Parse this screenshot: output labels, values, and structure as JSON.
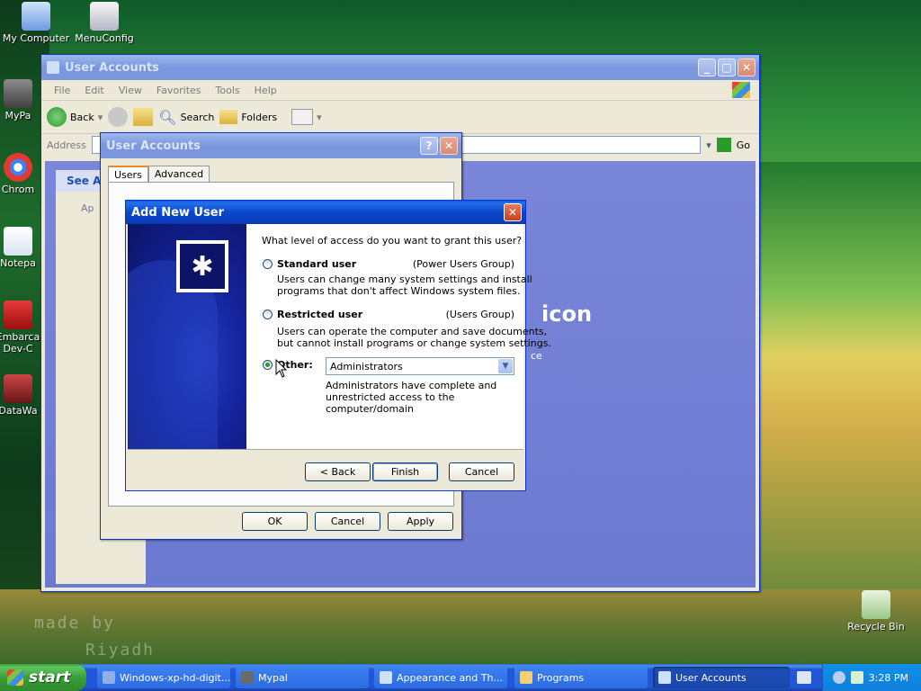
{
  "desktop": {
    "icons": [
      {
        "label": "My Computer"
      },
      {
        "label": "MenuConfig"
      },
      {
        "label": "MyPa"
      },
      {
        "label": "Chrom"
      },
      {
        "label": "Notepa"
      },
      {
        "label": "Embarca Dev-C"
      },
      {
        "label": "DataWa"
      },
      {
        "label": "Recycle Bin"
      }
    ],
    "watermark_line1": "made by",
    "watermark_line2": "Riyadh"
  },
  "explorer": {
    "title": "User Accounts",
    "menu": [
      "File",
      "Edit",
      "View",
      "Favorites",
      "Tools",
      "Help"
    ],
    "toolbar": {
      "back": "Back",
      "search": "Search",
      "folders": "Folders"
    },
    "address_label": "Address",
    "go_label": "Go",
    "see_all": "See Al",
    "left_item": "Ap",
    "heading_fragment": "icon",
    "text_fragment": "ce"
  },
  "user_accounts_dialog": {
    "title": "User Accounts",
    "tabs": [
      "Users",
      "Advanced"
    ],
    "ok": "OK",
    "cancel": "Cancel",
    "apply": "Apply"
  },
  "wizard": {
    "title": "Add New User",
    "question": "What level of access do you want to grant this user?",
    "standard": {
      "label": "Standard user",
      "group": "(Power Users Group)",
      "desc1": "Users can change many system settings and install",
      "desc2": "programs that don't affect Windows system files."
    },
    "restricted": {
      "label": "Restricted user",
      "group": "(Users Group)",
      "desc1": "Users can operate the computer and save documents,",
      "desc2": "but cannot install programs or change system settings."
    },
    "other": {
      "label": "Other:",
      "selected": "Administrators",
      "desc1": "Administrators have complete and",
      "desc2": "unrestricted access to the",
      "desc3": "computer/domain"
    },
    "back": "< Back",
    "finish": "Finish",
    "cancel": "Cancel"
  },
  "taskbar": {
    "start": "start",
    "tasks": [
      "Windows-xp-hd-digit...",
      "Mypal",
      "Appearance and Th...",
      "Programs",
      "User Accounts"
    ],
    "clock": "3:28 PM"
  },
  "colors": {
    "xp_blue": "#0a46c8",
    "selection_green": "#21a121",
    "explorer_body": "#7a86d8"
  }
}
